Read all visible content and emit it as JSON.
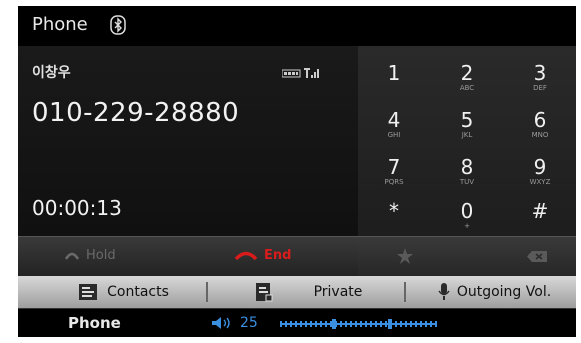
{
  "header": {
    "title": "Phone",
    "bluetooth_icon": "bluetooth-icon"
  },
  "call": {
    "caller_name": "이창우",
    "number": "010-229-28880",
    "duration": "00:00:13",
    "hold_label": "Hold",
    "end_label": "End"
  },
  "keypad": {
    "keys": [
      {
        "digit": "1",
        "letters": ""
      },
      {
        "digit": "2",
        "letters": "ABC"
      },
      {
        "digit": "3",
        "letters": "DEF"
      },
      {
        "digit": "4",
        "letters": "GHI"
      },
      {
        "digit": "5",
        "letters": "JKL"
      },
      {
        "digit": "6",
        "letters": "MNO"
      },
      {
        "digit": "7",
        "letters": "PQRS"
      },
      {
        "digit": "8",
        "letters": "TUV"
      },
      {
        "digit": "9",
        "letters": "WXYZ"
      },
      {
        "digit": "*",
        "letters": ""
      },
      {
        "digit": "0",
        "letters": "+"
      },
      {
        "digit": "#",
        "letters": ""
      }
    ]
  },
  "menu": {
    "contacts": "Contacts",
    "private": "Private",
    "outgoing_vol": "Outgoing Vol."
  },
  "statusbar": {
    "mode": "Phone",
    "volume": "25"
  },
  "colors": {
    "end_red": "#d81c1c",
    "volume_blue": "#3b8fe0"
  }
}
